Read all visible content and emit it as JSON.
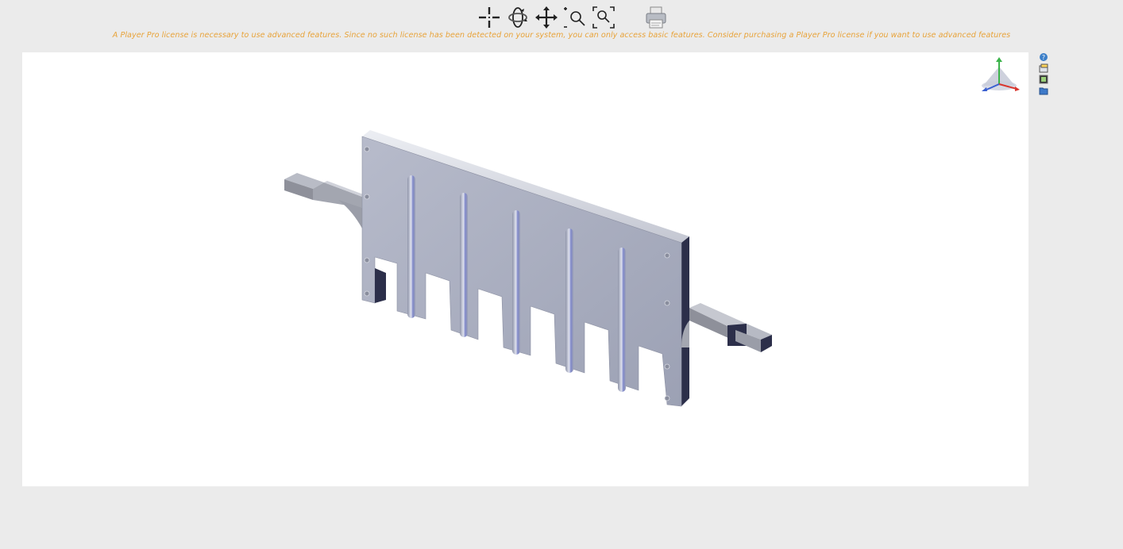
{
  "toolbar": {
    "tools": [
      {
        "name": "select-tool",
        "icon": "crosshair-icon"
      },
      {
        "name": "rotate-tool",
        "icon": "rotate-icon"
      },
      {
        "name": "pan-tool",
        "icon": "move-arrows-icon"
      },
      {
        "name": "zoom-tool",
        "icon": "zoom-in-out-icon"
      },
      {
        "name": "zoom-fit-tool",
        "icon": "zoom-fit-icon"
      },
      {
        "name": "print-tool",
        "icon": "printer-icon"
      }
    ]
  },
  "license_notice": "A Player Pro license is necessary to use advanced features. Since no such license has been detected on your system, you can only access basic features. Consider purchasing a Player Pro license if you want to use advanced features",
  "side_icons": [
    "help-icon",
    "window-icon",
    "background-icon",
    "folder-icon"
  ],
  "colors": {
    "page_bg": "#ebebeb",
    "viewport_bg": "#ffffff",
    "notice_text": "#e8a33a",
    "part_face": "#a9adbd",
    "part_dark": "#2c2f4a"
  }
}
